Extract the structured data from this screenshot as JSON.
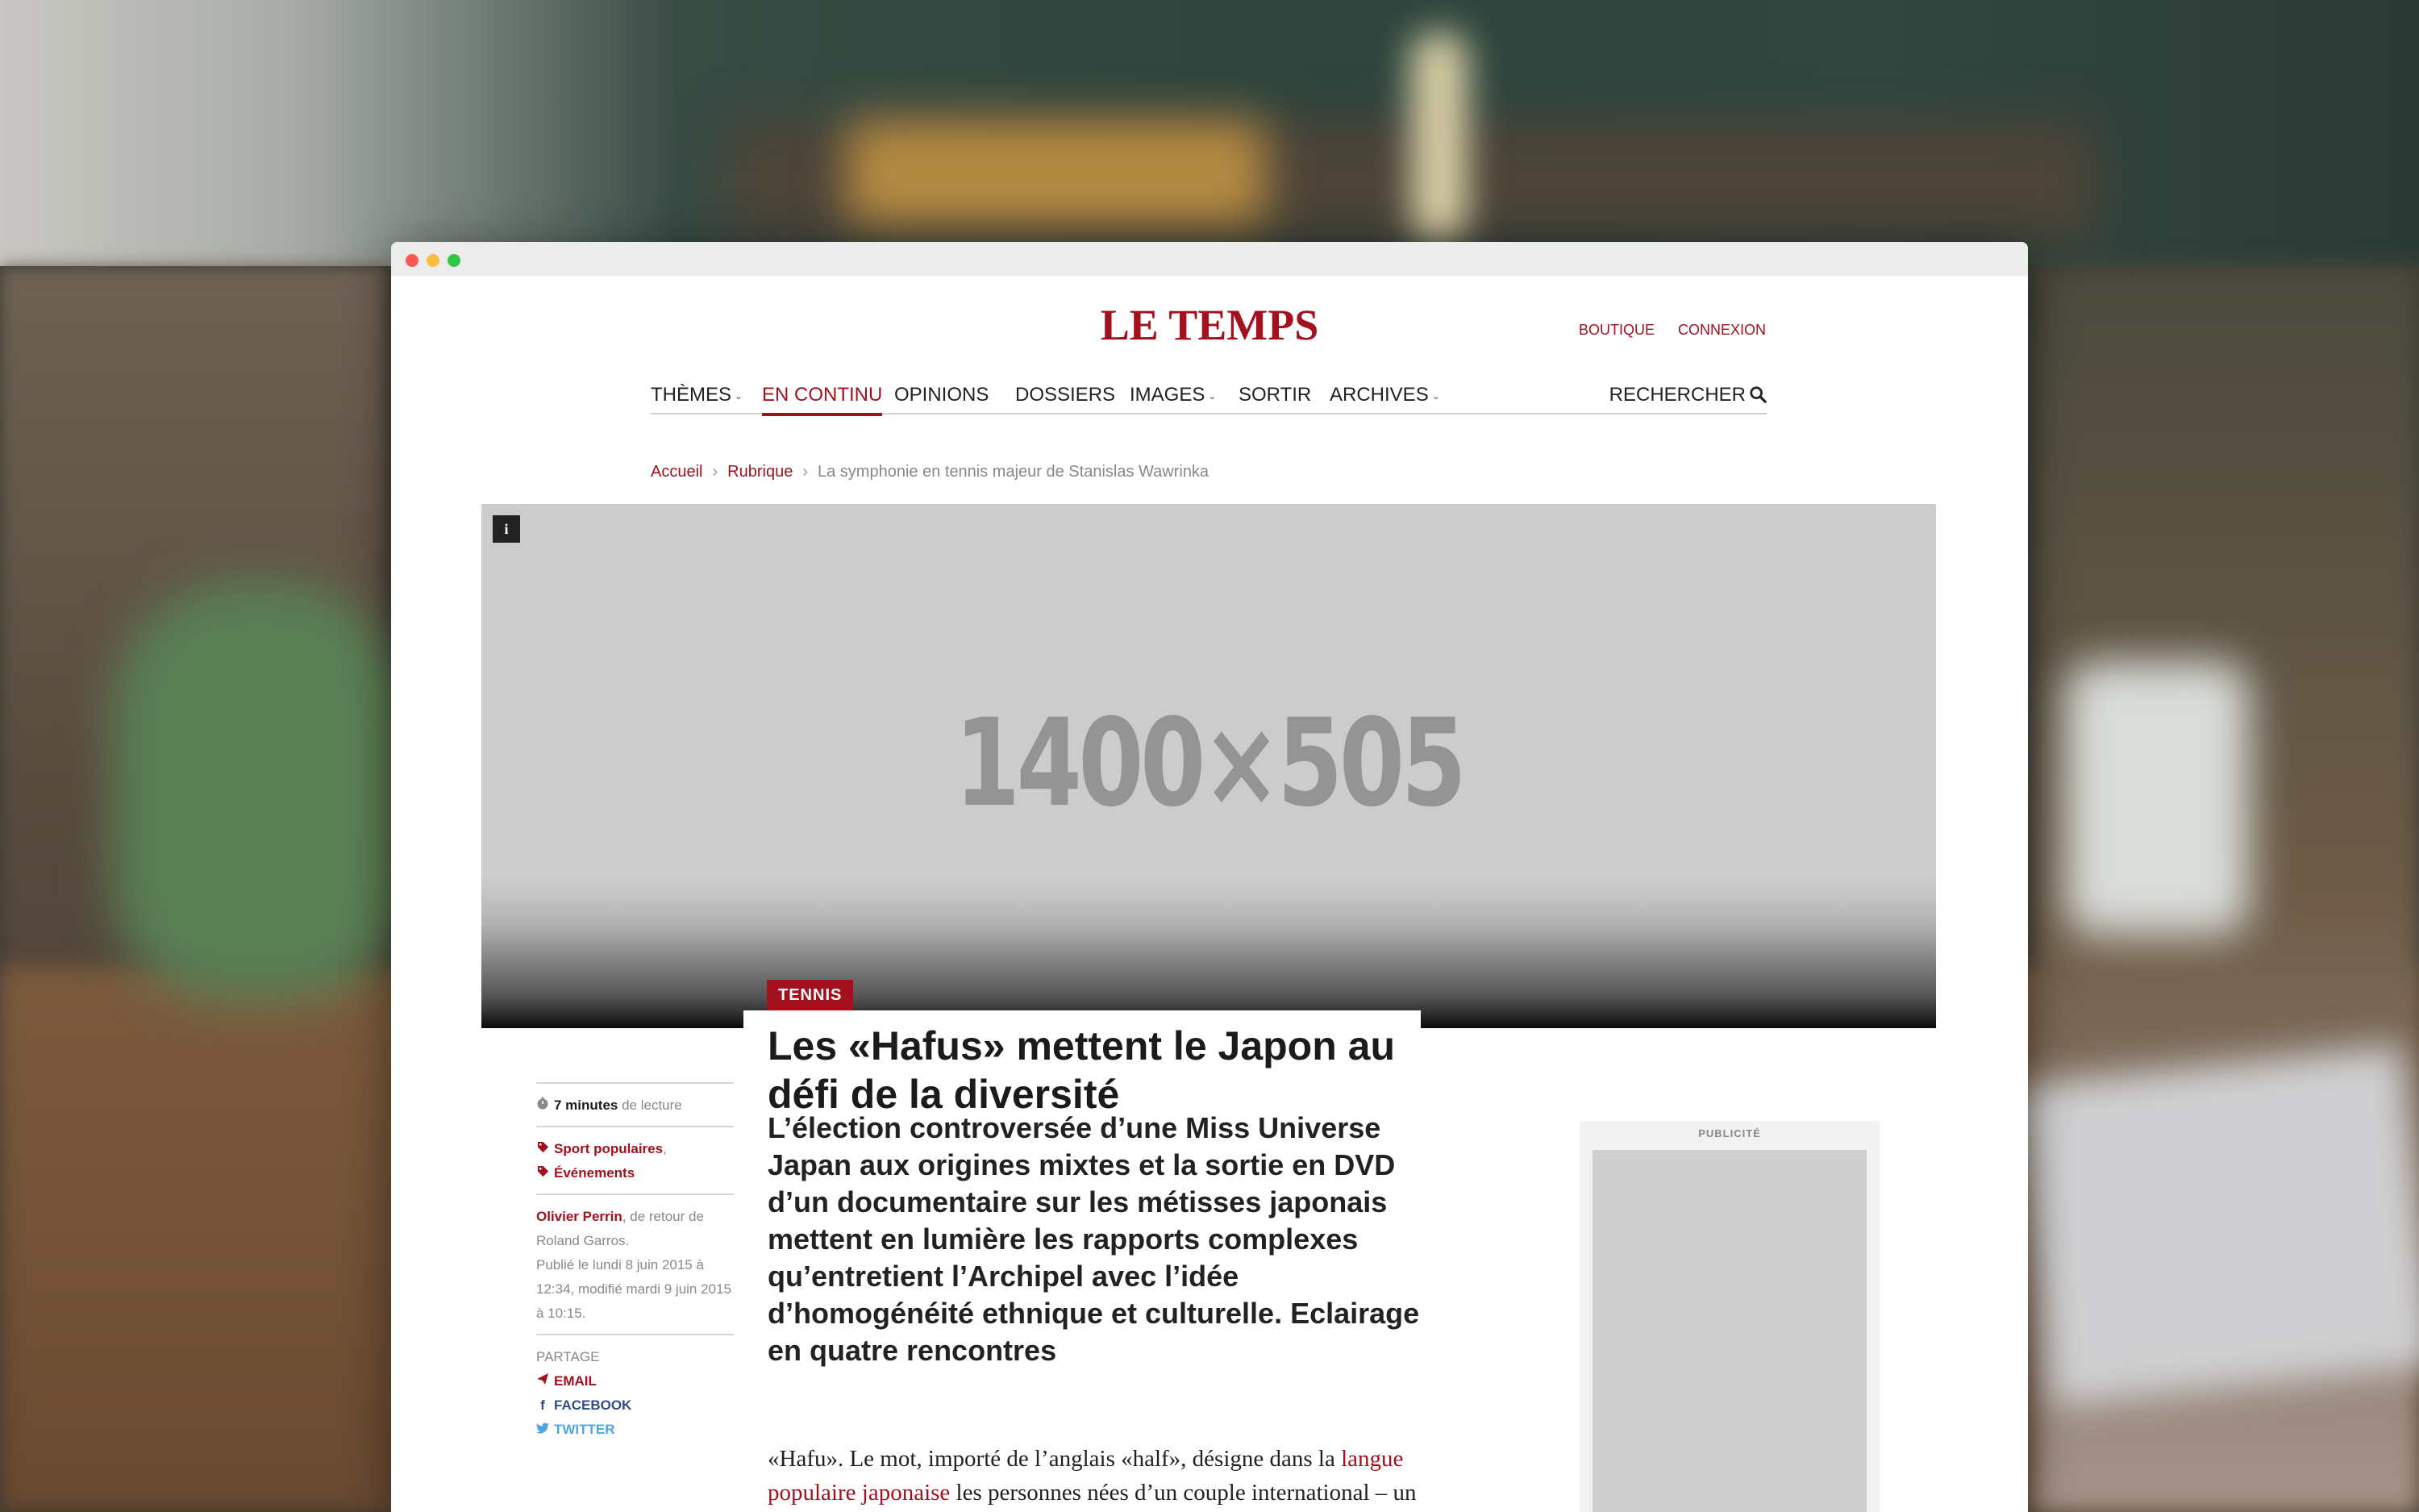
{
  "site": {
    "logo": "LE TEMPS",
    "util_links": [
      "BOUTIQUE",
      "CONNEXION"
    ]
  },
  "nav": {
    "items": [
      {
        "label": "THÈMES",
        "has_dropdown": true
      },
      {
        "label": "EN CONTINU",
        "active": true
      },
      {
        "label": "OPINIONS"
      },
      {
        "label": "DOSSIERS"
      },
      {
        "label": "IMAGES",
        "has_dropdown": true
      },
      {
        "label": "SORTIR"
      },
      {
        "label": "ARCHIVES",
        "has_dropdown": true
      }
    ],
    "search_label": "RECHERCHER"
  },
  "breadcrumb": {
    "items": [
      "Accueil",
      "Rubrique"
    ],
    "current": "La symphonie en tennis majeur de Stanislas Wawrinka"
  },
  "hero": {
    "info_glyph": "i",
    "placeholder_text": "1400×505"
  },
  "article": {
    "tag": "TENNIS",
    "title": "Les «Hafus» mettent le Japon au défi de la diversité",
    "lead": "L’élection controversée d’une Miss Universe Japan aux origines mixtes et la sortie en DVD d’un documentaire sur les métisses japonais mettent en lumière les rapports complexes qu’entretient l’Archipel avec l’idée d’homogénéité ethnique et culturelle. Eclairage en quatre rencontres",
    "body_start": "«Hafu». Le mot, importé de l’anglais «half», désigne dans la ",
    "body_link": "langue populaire japonaise",
    "body_end": " les personnes nées d’un couple international – un parent originaire de l’Archipel et l’autre originaire de l’étranger."
  },
  "meta": {
    "reading_time": "7 minutes",
    "reading_suffix": "de lecture",
    "tags": [
      "Sport populaires",
      "Événements"
    ],
    "tag_separator": ",",
    "author": "Olivier Perrin",
    "author_note": ", de retour de Roland Garros.",
    "published": "Publié le lundi 8 juin 2015 à 12:34, modifié mardi 9 juin 2015 à 10:15.",
    "share_label": "PARTAGE",
    "share": {
      "email": "EMAIL",
      "facebook": "FACEBOOK",
      "twitter": "TWITTER"
    }
  },
  "ad": {
    "label": "PUBLICITÉ"
  },
  "colors": {
    "brand": "#a3111f",
    "facebook": "#2f4d86",
    "twitter": "#4da7de"
  }
}
